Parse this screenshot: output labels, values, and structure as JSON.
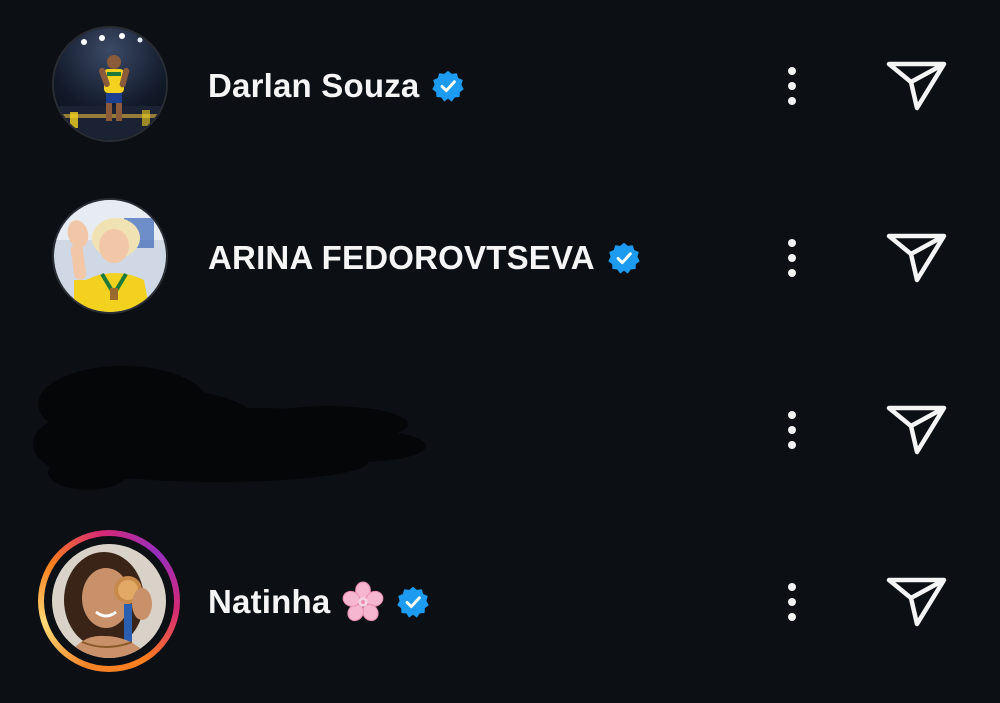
{
  "accounts": [
    {
      "username": "Darlan Souza",
      "verified": true,
      "has_story": false,
      "avatar": "volleyball-player-yellow-jersey-photo"
    },
    {
      "username": "ARINA FEDOROVTSEVA",
      "verified": true,
      "has_story": false,
      "avatar": "blonde-athlete-yellow-jersey-photo"
    },
    {
      "username": "",
      "verified": false,
      "has_story": false,
      "avatar": "redacted"
    },
    {
      "username": "Natinha",
      "emoji": "cherry-blossom",
      "verified": true,
      "has_story": true,
      "avatar": "woman-holding-medal-photo"
    }
  ],
  "icons": {
    "more": "more-vertical-icon",
    "send": "send-paper-plane-icon",
    "verified": "verified-badge-icon"
  },
  "colors": {
    "background": "#0c0f14",
    "text": "#f5f5f5",
    "verified_blue": "#1d9bf0",
    "story_ring": [
      "#f58529",
      "#feda75",
      "#d62976",
      "#962fbf"
    ]
  }
}
